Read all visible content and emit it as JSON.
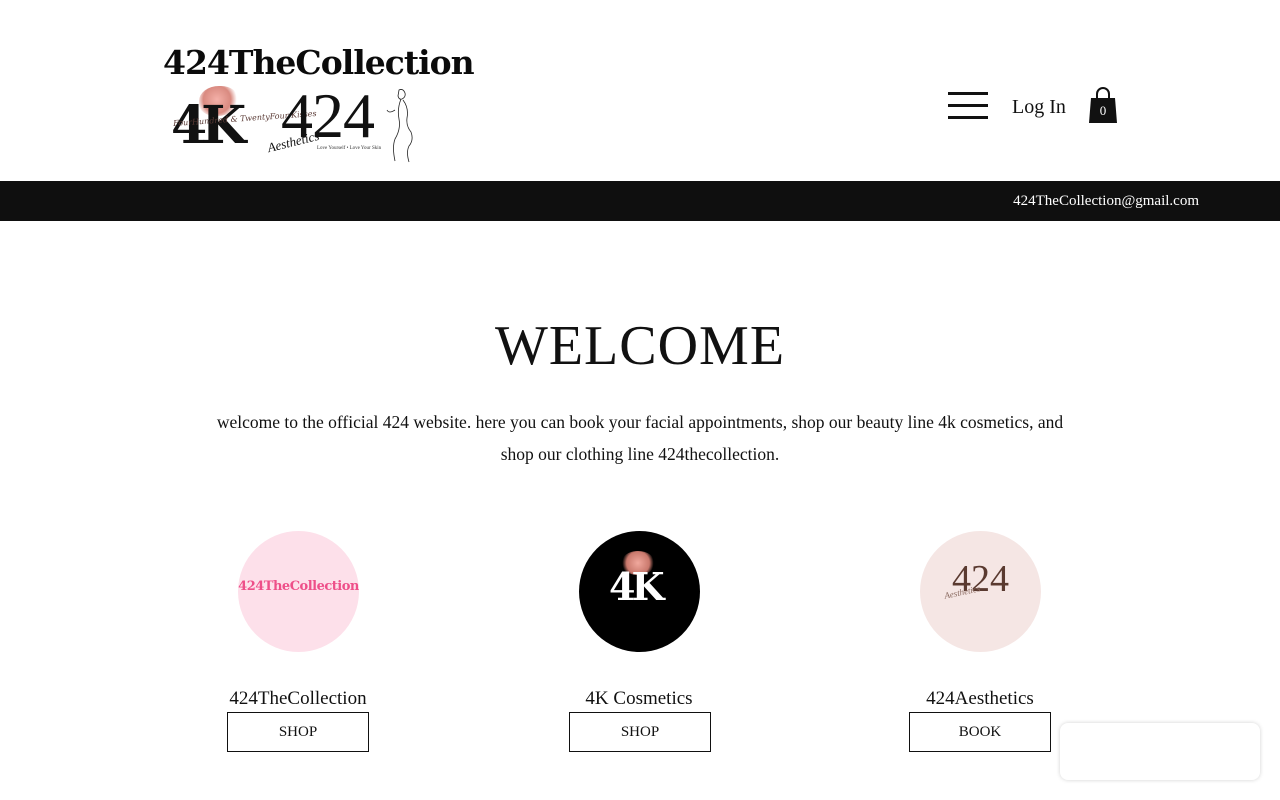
{
  "header": {
    "logo_title": "424TheCollection",
    "logo_4k": "4K",
    "logo_4k_script": "FourHundred & TwentyFour Kisses",
    "logo_424": "424",
    "logo_424_script": "Aesthetics",
    "logo_424_tagline": "Love Yourself • Love Your Skin",
    "login_label": "Log In",
    "cart_count": "0"
  },
  "topbar": {
    "email": "424TheCollection@gmail.com"
  },
  "main": {
    "heading": "WELCOME",
    "intro": "welcome to the official 424 website. here you can book your facial appointments, shop our beauty line 4k cosmetics, and shop our clothing line 424thecollection."
  },
  "cards": [
    {
      "logo_text": "424TheCollection",
      "title": "424TheCollection",
      "button": "SHOP"
    },
    {
      "logo_text": "4K",
      "title": "4K Cosmetics",
      "button": "SHOP"
    },
    {
      "logo_text": "424",
      "logo_script": "Aesthetics",
      "title": "424Aesthetics",
      "button": "BOOK"
    }
  ],
  "colors": {
    "topbar": "#0f0f0f",
    "pink_circle": "#fde0ea",
    "pink_text": "#ee4f89",
    "beige_circle": "#f5e6e4"
  }
}
